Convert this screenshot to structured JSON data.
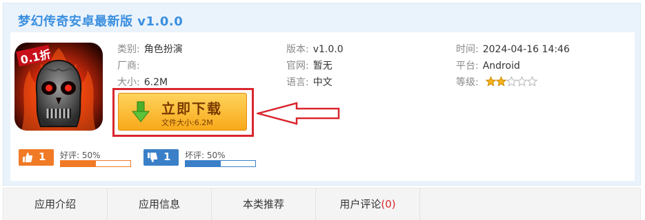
{
  "app": {
    "title": "梦幻传奇安卓最新版 v1.0.0",
    "icon_badge": "0.1折"
  },
  "meta": {
    "category": {
      "label": "类别:",
      "value": "角色扮演"
    },
    "vendor": {
      "label": "厂商:",
      "value": ""
    },
    "size": {
      "label": "大小:",
      "value": "6.2M"
    },
    "version": {
      "label": "版本:",
      "value": "v1.0.0"
    },
    "website": {
      "label": "官网:",
      "value": "暂无"
    },
    "language": {
      "label": "语言:",
      "value": "中文"
    },
    "time": {
      "label": "时间:",
      "value": "2024-04-16 14:46"
    },
    "platform": {
      "label": "平台:",
      "value": "Android"
    },
    "rating": {
      "label": "等级:",
      "stars_filled": 2,
      "stars_total": 5
    }
  },
  "download": {
    "label": "立即下载",
    "sublabel": "文件大小:6.2M"
  },
  "votes": {
    "good": {
      "count": "1",
      "label": "好评: 50%",
      "percent": 50,
      "color": "#f07a25"
    },
    "bad": {
      "count": "1",
      "label": "坏评: 50%",
      "percent": 50,
      "color": "#3a7fc8"
    }
  },
  "tabs": [
    {
      "label": "应用介绍"
    },
    {
      "label": "应用信息"
    },
    {
      "label": "本类推荐"
    },
    {
      "label": "用户评论",
      "count": "(0)"
    }
  ],
  "colors": {
    "title": "#3a8fe0",
    "highlight_frame": "#d9252d",
    "download_button": "#f8a91a"
  }
}
